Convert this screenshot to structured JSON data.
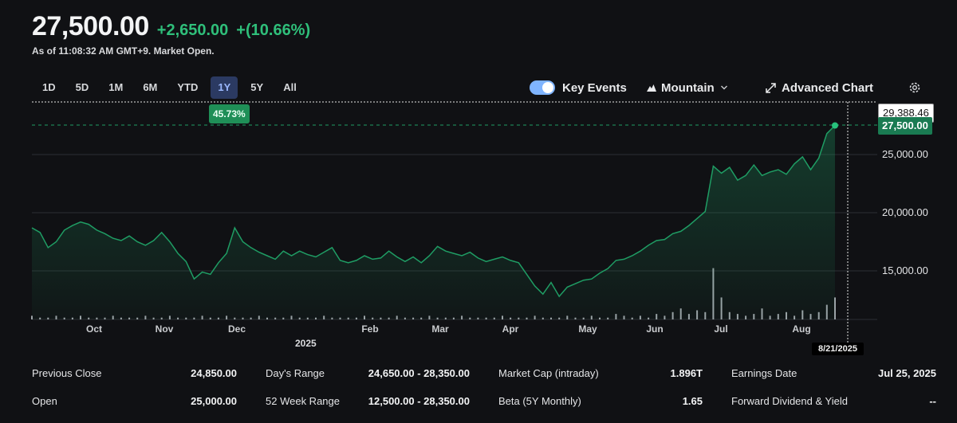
{
  "quote": {
    "price": "27,500.00",
    "change": "+2,650.00",
    "change_pct": "+(10.66%)",
    "as_of": "As of 11:08:32 AM GMT+9. Market Open."
  },
  "ranges": [
    "1D",
    "5D",
    "1M",
    "6M",
    "YTD",
    "1Y",
    "5Y",
    "All"
  ],
  "active_range": "1Y",
  "toolbar": {
    "key_events": "Key Events",
    "key_events_on": true,
    "chart_type": "Mountain",
    "advanced": "Advanced Chart"
  },
  "chart": {
    "range_change_badge": "45.73%",
    "crosshair_value": "29,388.46",
    "last_price_tag": "27,500.00",
    "crosshair_date": "8/21/2025",
    "year_label": "2025",
    "y_ticks": [
      "25,000.00",
      "20,000.00",
      "15,000.00"
    ]
  },
  "chart_data": {
    "type": "area",
    "title": "",
    "xlabel": "",
    "ylabel": "",
    "x_ticks": [
      "Oct",
      "Nov",
      "Dec",
      "Feb",
      "Mar",
      "Apr",
      "May",
      "Jun",
      "Jul",
      "Aug"
    ],
    "ylim": [
      11000,
      29388
    ],
    "series": [
      {
        "values": [
          18700,
          18300,
          17000,
          17500,
          18500,
          18900,
          19200,
          19000,
          18500,
          18200,
          17800,
          17600,
          18000,
          17500,
          17200,
          17600,
          18300,
          17500,
          16500,
          15800,
          14300,
          14900,
          14700,
          15700,
          16500,
          18700,
          17500,
          17000,
          16600,
          16300,
          16000,
          16700,
          16300,
          16700,
          16400,
          16200,
          16600,
          17000,
          15900,
          15700,
          15900,
          16300,
          16000,
          16100,
          16700,
          16200,
          15800,
          16200,
          15700,
          16300,
          17100,
          16700,
          16500,
          16300,
          16600,
          16100,
          15800,
          16000,
          16200,
          15900,
          15700,
          14700,
          13700,
          13000,
          14000,
          12800,
          13600,
          13900,
          14200,
          14300,
          14800,
          15200,
          15900,
          16000,
          16300,
          16700,
          17200,
          17600,
          17700,
          18200,
          18400,
          18900,
          19500,
          20100,
          24000,
          23400,
          23900,
          22800,
          23200,
          24100,
          23200,
          23500,
          23700,
          23300,
          24200,
          24800,
          23700,
          24700,
          26800,
          27500
        ]
      }
    ],
    "volume": [
      2,
      1,
      1,
      2,
      1,
      1,
      2,
      1,
      1,
      1,
      2,
      1,
      1,
      1,
      2,
      1,
      1,
      2,
      1,
      1,
      1,
      2,
      1,
      1,
      2,
      1,
      1,
      1,
      2,
      1,
      1,
      1,
      2,
      1,
      1,
      1,
      2,
      1,
      1,
      1,
      1,
      2,
      1,
      1,
      1,
      2,
      1,
      1,
      1,
      2,
      1,
      1,
      1,
      2,
      1,
      1,
      1,
      1,
      2,
      1,
      1,
      1,
      2,
      1,
      1,
      1,
      2,
      1,
      1,
      2,
      1,
      1,
      3,
      2,
      1,
      2,
      1,
      3,
      2,
      4,
      6,
      3,
      5,
      4,
      28,
      12,
      4,
      3,
      2,
      3,
      6,
      2,
      3,
      4,
      2,
      5,
      3,
      4,
      8,
      12
    ],
    "grid": true,
    "legend": "none"
  },
  "stats": [
    [
      [
        "Previous Close",
        "24,850.00"
      ],
      [
        "Open",
        "25,000.00"
      ]
    ],
    [
      [
        "Day's Range",
        "24,650.00 - 28,350.00"
      ],
      [
        "52 Week Range",
        "12,500.00 - 28,350.00"
      ]
    ],
    [
      [
        "Market Cap (intraday)",
        "1.896T"
      ],
      [
        "Beta (5Y Monthly)",
        "1.65"
      ]
    ],
    [
      [
        "Earnings Date",
        "Jul 25, 2025"
      ],
      [
        "Forward Dividend & Yield",
        "--"
      ]
    ]
  ],
  "colors": {
    "accent_green": "#2fbf7a",
    "line": "#1f9d64",
    "active_range_bg": "#2b3a62",
    "toggle": "#7fb4ff"
  }
}
